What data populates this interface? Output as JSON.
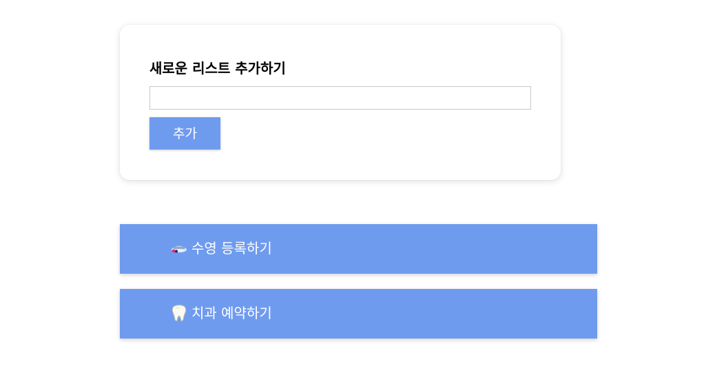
{
  "form": {
    "title": "새로운 리스트 추가하기",
    "input_value": "",
    "input_placeholder": "",
    "add_button_label": "추가"
  },
  "list": {
    "items": [
      {
        "icon": "swim-goggles-icon",
        "label": "수영 등록하기"
      },
      {
        "icon": "tooth-icon",
        "label": "치과 예약하기"
      }
    ]
  },
  "colors": {
    "accent": "#6f9bef",
    "card_bg": "#ffffff",
    "input_border": "#c8c8c8",
    "text_on_accent": "#ffffff"
  }
}
